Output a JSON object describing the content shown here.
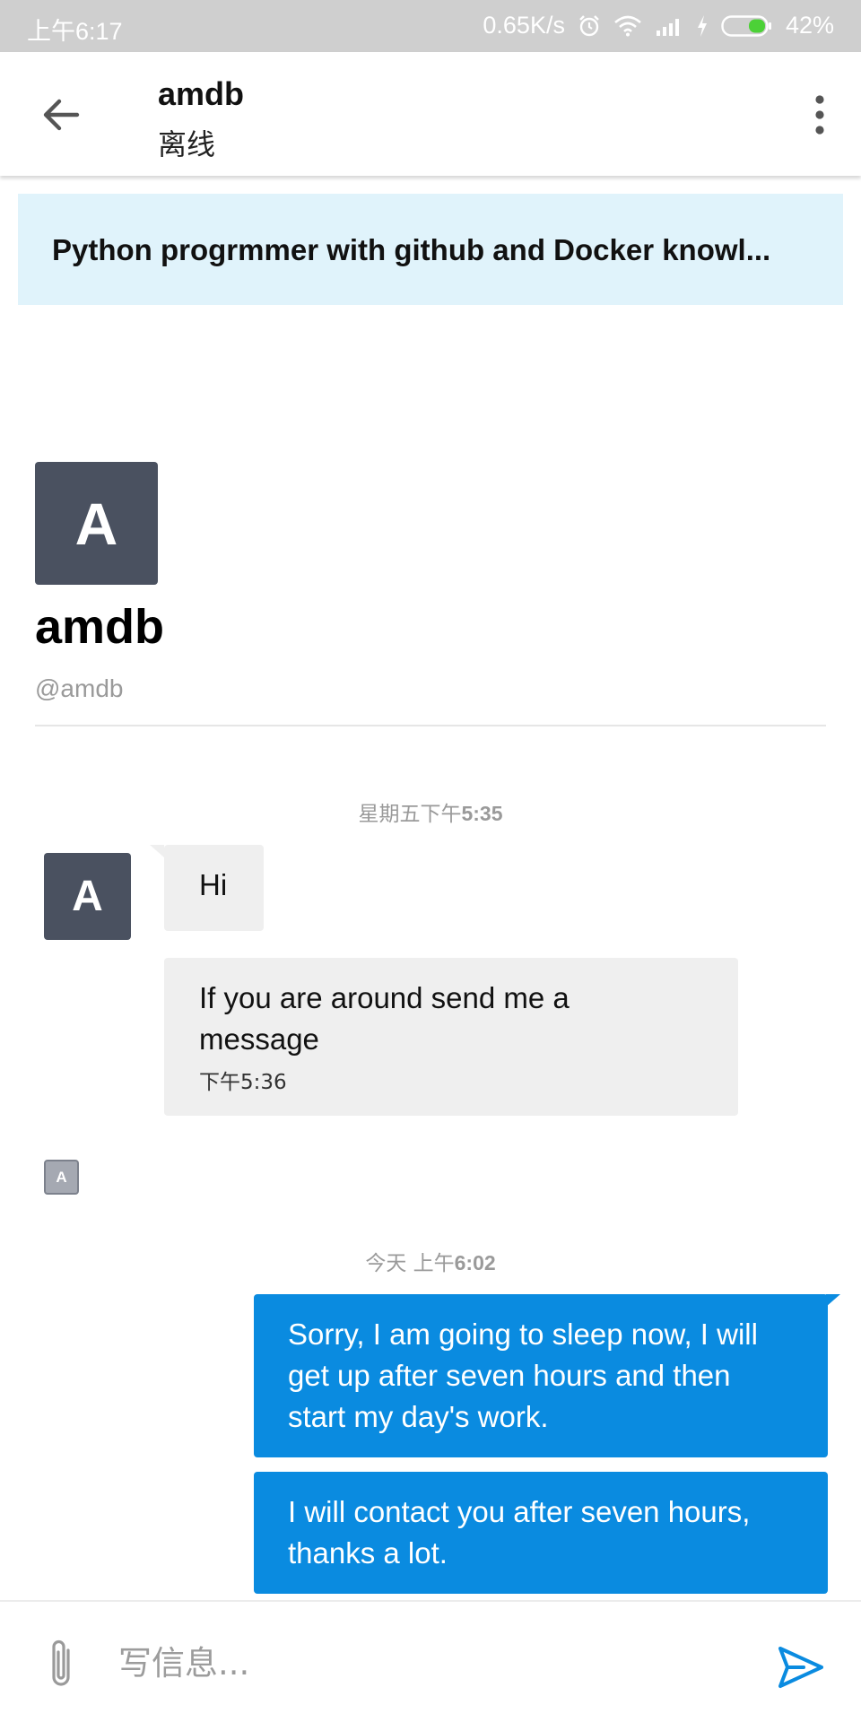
{
  "status_bar": {
    "time": "上午6:17",
    "net_speed": "0.65K/s",
    "battery": "42%",
    "icons": [
      "alarm-icon",
      "wifi-icon",
      "signal-icon",
      "charging-icon",
      "battery-icon"
    ]
  },
  "header": {
    "title": "amdb",
    "subtitle": "离线",
    "icons": [
      "back-arrow-icon",
      "more-vertical-icon"
    ]
  },
  "banner": {
    "text": "Python progrmmer with github and Docker knowl..."
  },
  "profile": {
    "avatar_letter": "A",
    "name": "amdb",
    "handle": "@amdb"
  },
  "conversation": {
    "date1": {
      "prefix": "星期五下午",
      "time": "5:35"
    },
    "incoming": {
      "avatar_letter": "A",
      "messages": [
        {
          "text": "Hi"
        },
        {
          "text_line1": "If you are around send me a",
          "text_line2": "message",
          "time": "下午5:36"
        }
      ],
      "read_avatar_letter": "A"
    },
    "date2": {
      "prefix": "今天 上午",
      "time": "6:02"
    },
    "outgoing": [
      {
        "line1": "Sorry, I am going to sleep now, I will",
        "line2": "get up after seven hours and then",
        "line3": "start my day's work."
      },
      {
        "line1": "I will contact you after seven hours,",
        "line2": "thanks a lot."
      }
    ]
  },
  "composer": {
    "placeholder": "写信息...",
    "value": "",
    "icons": [
      "paperclip-icon",
      "send-icon"
    ]
  },
  "colors": {
    "accent": "#0a8be0",
    "banner_bg": "#e0f3fb",
    "avatar_bg": "#4a5160",
    "incoming_bubble": "#efefef"
  }
}
